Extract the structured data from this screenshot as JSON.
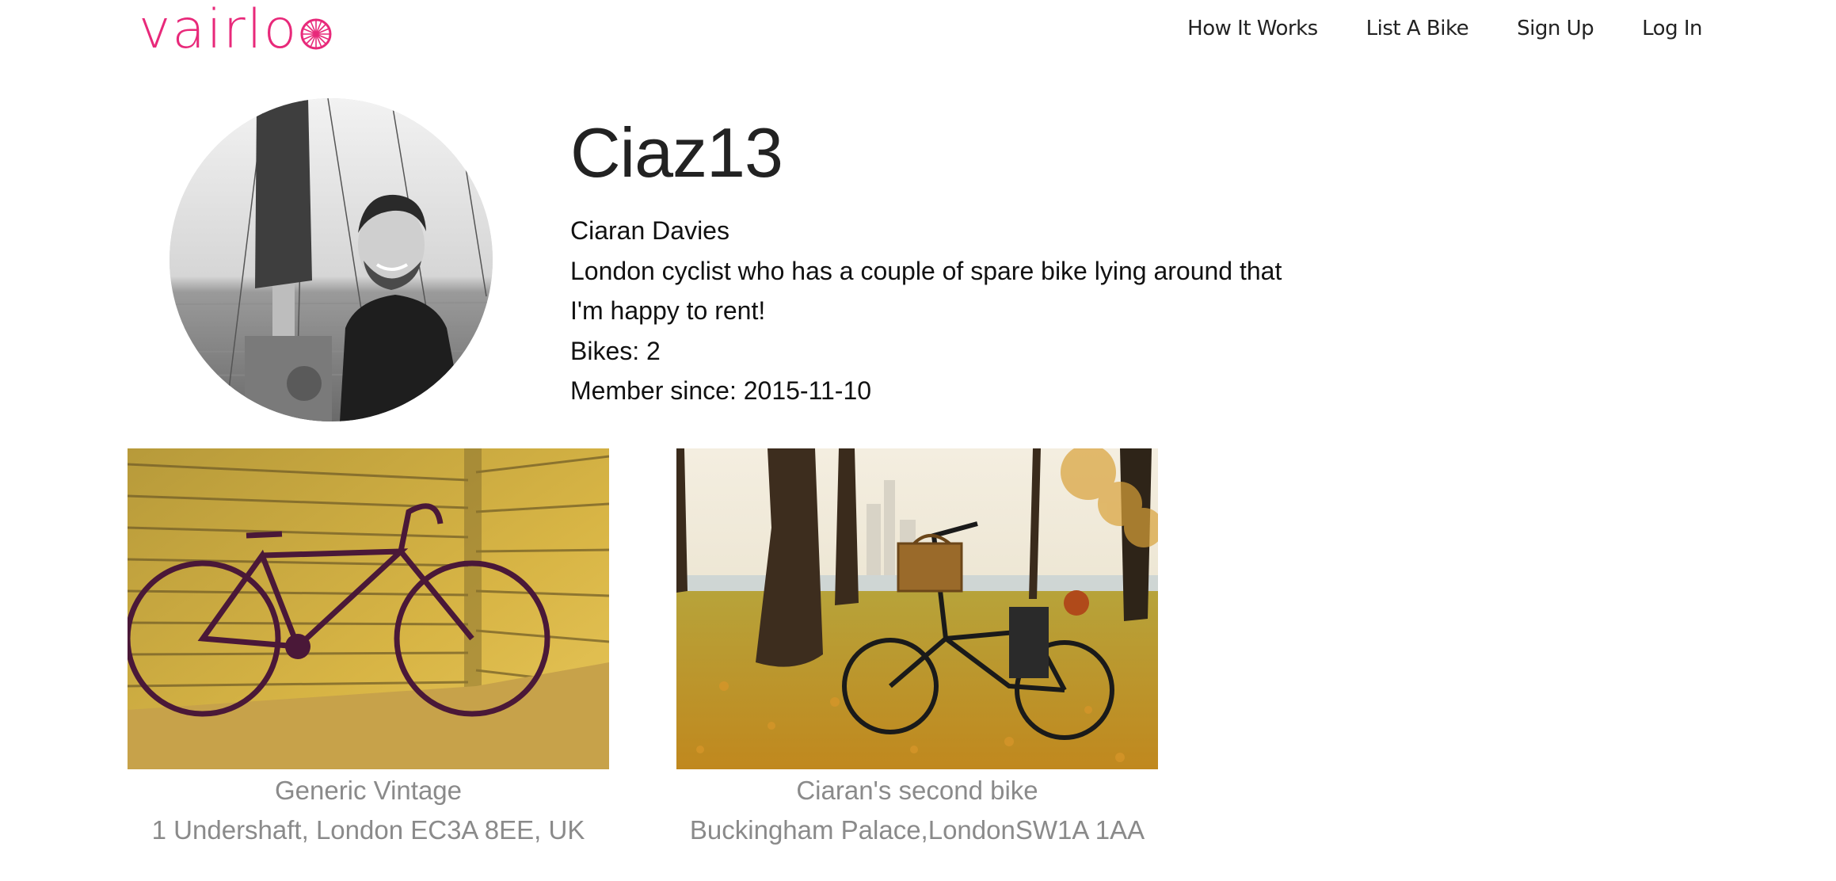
{
  "app": {
    "brand": "vairlo",
    "brand_color": "#e8297a"
  },
  "nav": {
    "items": [
      {
        "label": "How It Works"
      },
      {
        "label": "List A Bike"
      },
      {
        "label": "Sign Up"
      },
      {
        "label": "Log In"
      }
    ]
  },
  "profile": {
    "username": "Ciaz13",
    "full_name": "Ciaran Davies",
    "bio": "London cyclist who has a couple of spare bike lying around that I'm happy to rent!",
    "bikes": "Bikes: 2",
    "member_since": "Member since: 2015-11-10"
  },
  "bikes": [
    {
      "name": "Generic Vintage",
      "address": "1 Undershaft, London EC3A 8EE, UK"
    },
    {
      "name": "Ciaran's second bike",
      "address": "Buckingham Palace,LondonSW1A 1AA"
    }
  ],
  "colors": {
    "text": "#222222",
    "muted": "#8a8a8a"
  }
}
